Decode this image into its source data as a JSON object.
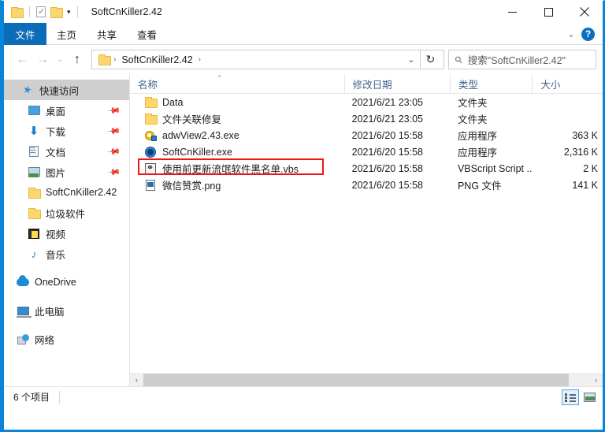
{
  "window": {
    "title": "SoftCnKiller2.42",
    "quick_access_toolbar": [
      {
        "icon": "folder-icon",
        "name": "properties-folder-icon"
      },
      {
        "icon": "properties-icon",
        "name": "properties-icon"
      },
      {
        "icon": "new-folder-icon",
        "name": "new-folder-icon"
      }
    ],
    "qat_dropdown_glyph": "▾",
    "controls": {
      "minimize": "—",
      "maximize": "□",
      "close": "✕"
    }
  },
  "ribbon": {
    "tabs": [
      {
        "label": "文件",
        "selected": true
      },
      {
        "label": "主页",
        "selected": false
      },
      {
        "label": "共享",
        "selected": false
      },
      {
        "label": "查看",
        "selected": false
      }
    ],
    "expand_glyph": "⌄",
    "help_glyph": "?"
  },
  "address_bar": {
    "back_glyph": "←",
    "forward_glyph": "→",
    "history_glyph": "⌄",
    "up_glyph": "↑",
    "breadcrumb": {
      "folder_icon": "folder-icon",
      "separator_left": "›",
      "path": "SoftCnKiller2.42",
      "separator_right": "›"
    },
    "breadcrumb_dropdown_glyph": "⌄",
    "refresh_glyph": "↻",
    "search": {
      "icon": "search-icon",
      "placeholder": "搜索\"SoftCnKiller2.42\""
    }
  },
  "sidebar": {
    "items": [
      {
        "label": "快速访问",
        "icon": "pin-star-icon",
        "selected": true,
        "pinned": false,
        "indent": false
      },
      {
        "label": "桌面",
        "icon": "desktop-icon",
        "selected": false,
        "pinned": true,
        "indent": true
      },
      {
        "label": "下载",
        "icon": "download-icon",
        "selected": false,
        "pinned": true,
        "indent": true
      },
      {
        "label": "文档",
        "icon": "documents-icon",
        "selected": false,
        "pinned": true,
        "indent": true
      },
      {
        "label": "图片",
        "icon": "pictures-icon",
        "selected": false,
        "pinned": true,
        "indent": true
      },
      {
        "label": "SoftCnKiller2.42",
        "icon": "folder-icon",
        "selected": false,
        "pinned": false,
        "indent": true
      },
      {
        "label": "垃圾软件",
        "icon": "folder-icon",
        "selected": false,
        "pinned": false,
        "indent": true
      },
      {
        "label": "视频",
        "icon": "videos-icon",
        "selected": false,
        "pinned": false,
        "indent": true
      },
      {
        "label": "音乐",
        "icon": "music-icon",
        "selected": false,
        "pinned": false,
        "indent": true
      },
      {
        "label": "OneDrive",
        "icon": "onedrive-cloud-icon",
        "selected": false,
        "pinned": false,
        "indent": false,
        "root": true
      },
      {
        "label": "此电脑",
        "icon": "this-pc-icon",
        "selected": false,
        "pinned": false,
        "indent": false,
        "root": true
      },
      {
        "label": "网络",
        "icon": "network-icon",
        "selected": false,
        "pinned": false,
        "indent": false,
        "root": true
      }
    ],
    "pin_glyph": "📌"
  },
  "file_list": {
    "columns": [
      {
        "label": "名称",
        "sorted": true,
        "sort_glyph": "⌃"
      },
      {
        "label": "修改日期",
        "sorted": false
      },
      {
        "label": "类型",
        "sorted": false
      },
      {
        "label": "大小",
        "sorted": false
      }
    ],
    "rows": [
      {
        "name": "Data",
        "icon": "folder-icon",
        "date": "2021/6/21 23:05",
        "type": "文件夹",
        "size": "",
        "highlighted": false
      },
      {
        "name": "文件关联修复",
        "icon": "folder-icon",
        "date": "2021/6/21 23:05",
        "type": "文件夹",
        "size": "",
        "highlighted": false
      },
      {
        "name": "adwView2.43.exe",
        "icon": "application-icon",
        "date": "2021/6/20 15:58",
        "type": "应用程序",
        "size": "363 K",
        "highlighted": false
      },
      {
        "name": "SoftCnKiller.exe",
        "icon": "globe-application-icon",
        "date": "2021/6/20 15:58",
        "type": "应用程序",
        "size": "2,316 K",
        "highlighted": false
      },
      {
        "name": "使用前更新流氓软件黑名单.vbs",
        "icon": "vbscript-icon",
        "date": "2021/6/20 15:58",
        "type": "VBScript Script ...",
        "size": "2 K",
        "highlighted": true
      },
      {
        "name": "微信赞赏.png",
        "icon": "png-image-icon",
        "date": "2021/6/20 15:58",
        "type": "PNG 文件",
        "size": "141 K",
        "highlighted": false
      }
    ],
    "highlight_color": "#f11616",
    "scrollbar": {
      "left_glyph": "‹",
      "right_glyph": "›"
    }
  },
  "status_bar": {
    "item_count": "6 个项目",
    "view_buttons": [
      {
        "name": "details-view-button",
        "icon": "details-view-icon",
        "selected": true
      },
      {
        "name": "large-icons-view-button",
        "icon": "large-icons-view-icon",
        "selected": false
      }
    ]
  },
  "colors": {
    "window_border": "#0a84d8",
    "file_tab": "#0d6cb8",
    "column_header_text": "#41638d",
    "selection_grey": "#cfcfcf"
  }
}
